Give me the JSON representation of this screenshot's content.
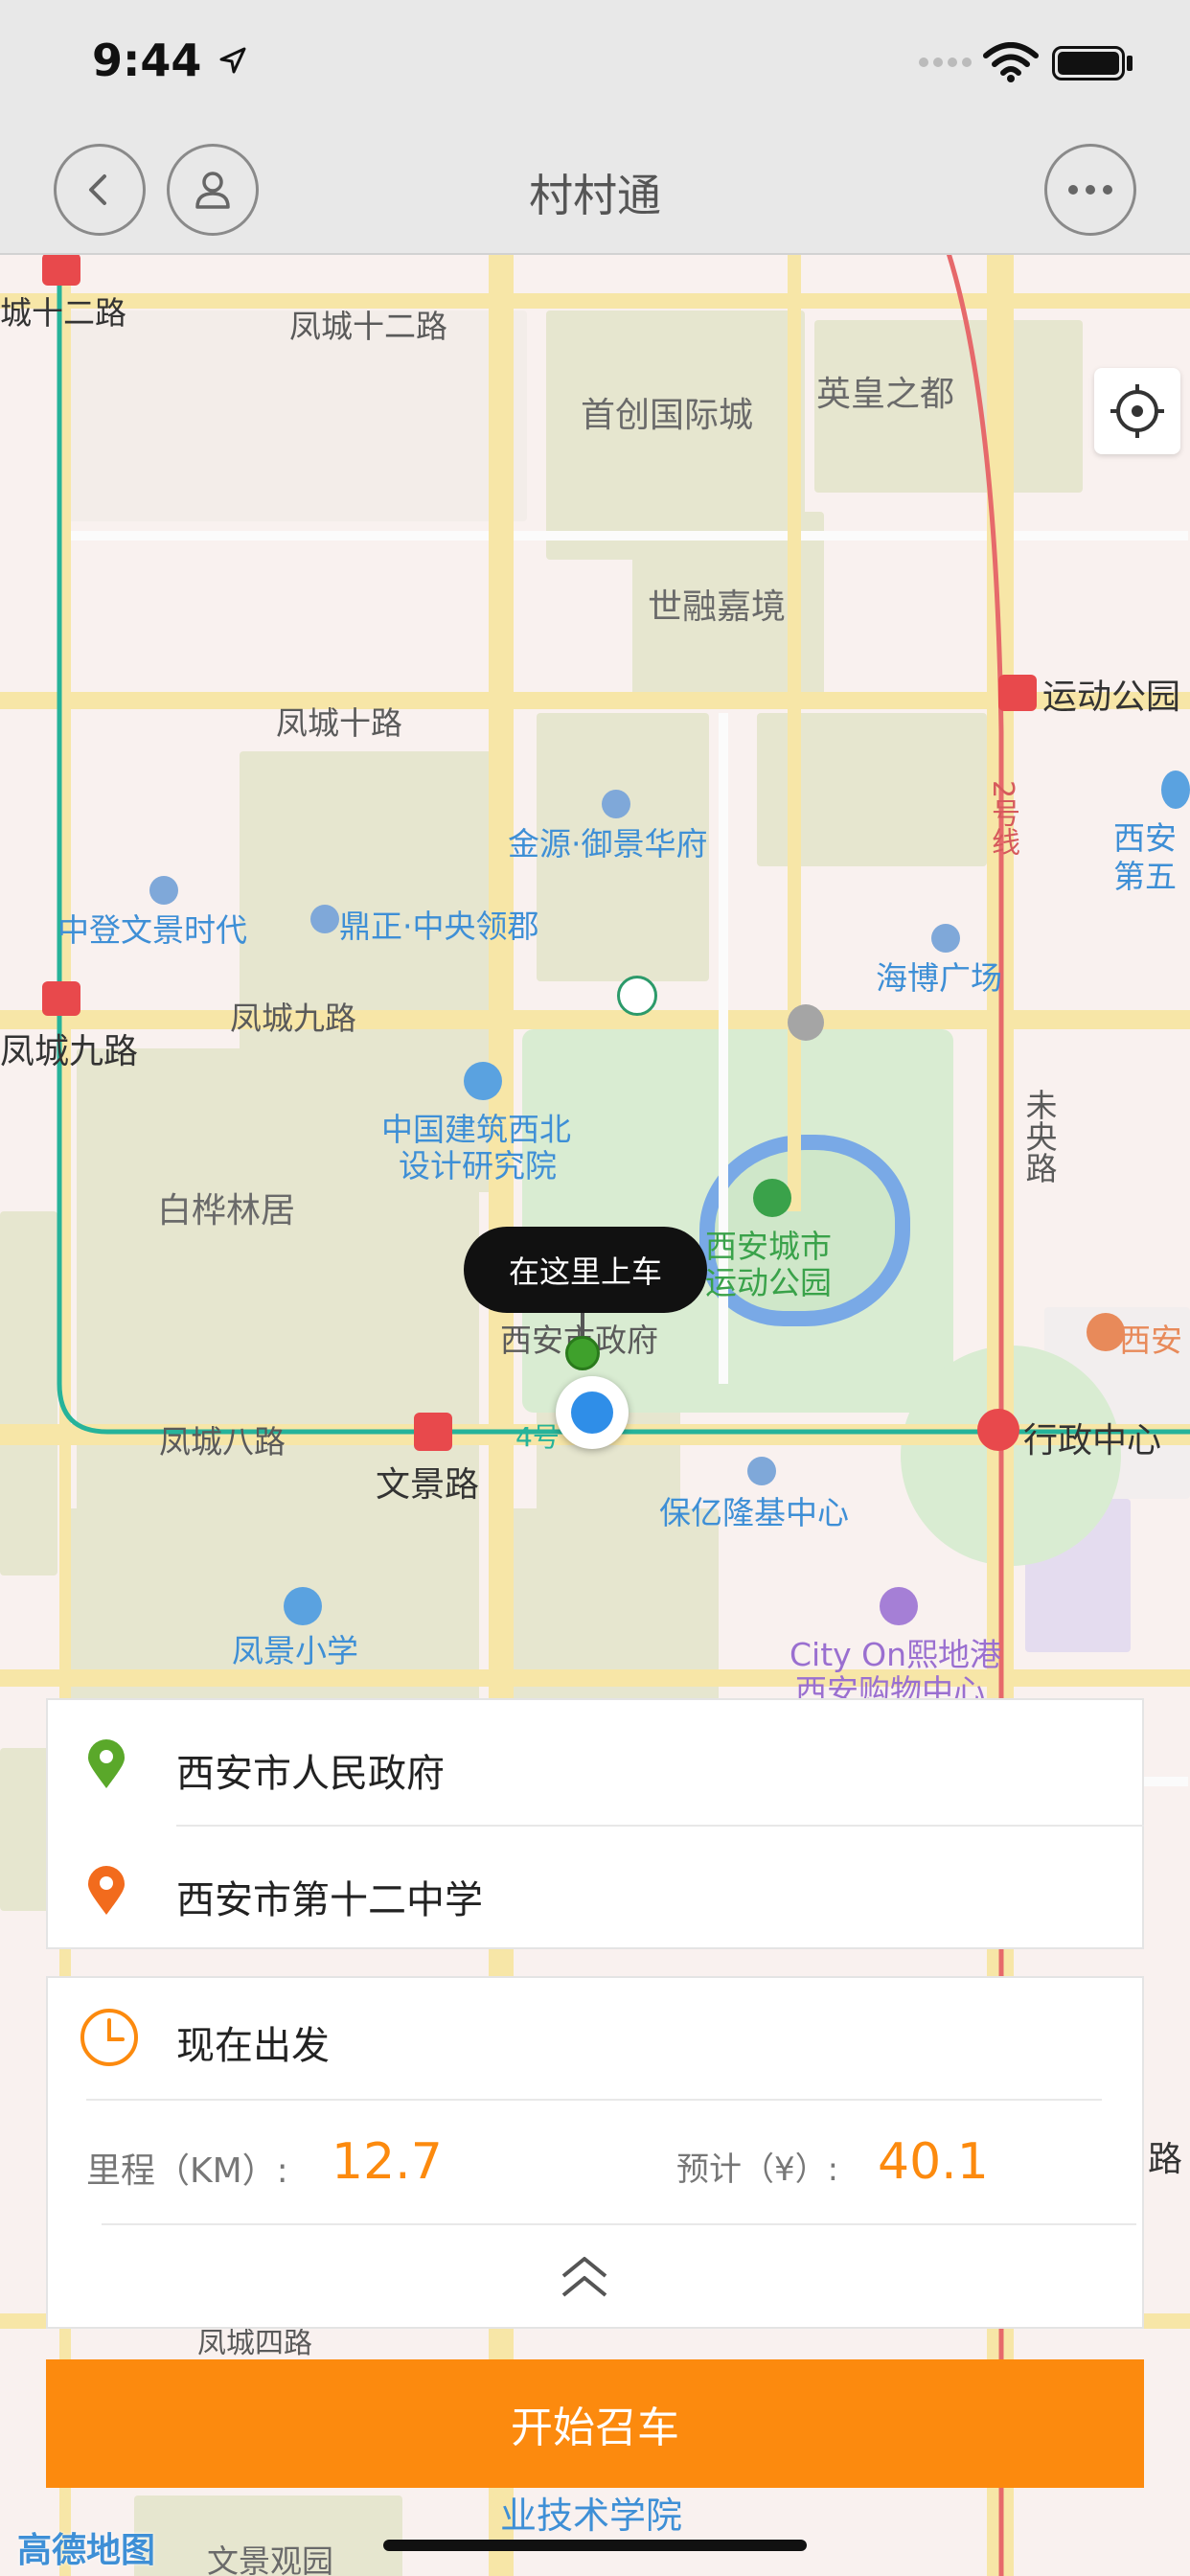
{
  "status_bar": {
    "time": "9:44"
  },
  "nav": {
    "title": "村村通"
  },
  "map": {
    "labels": {
      "r1": "凤城十二路",
      "r1b": "城十二路",
      "shouchuang": "首创国际城",
      "yinghuang": "英皇之都",
      "shirong": "世融嘉境",
      "r10": "凤城十路",
      "yundong": "运动公园",
      "jinyuan": "金源·御景华府",
      "xian_di5": "西安",
      "xian_di5b": "第五",
      "zhongdeng": "中登文景时代",
      "dingzheng": "鼎正·中央领郡",
      "haibo": "海博广场",
      "line2": "2号线",
      "r9": "凤城九路",
      "r9b": "凤城九路",
      "zhongjian1": "中国建筑西北",
      "zhongjian2": "设计研究院",
      "weiyang": "未央路",
      "baihua": "白桦林居",
      "xian_park1": "西安城市",
      "xian_park2": "运动公园",
      "gov": "西安市政府",
      "xian_r": "西安",
      "r8": "凤城八路",
      "line4": "4号",
      "xingzheng": "行政中心",
      "wenjing": "文景路",
      "baoyi": "保亿隆基中心",
      "fengjing": "凤景小学",
      "cityon1": "City On熙地港",
      "cityon2": "西安购物中心",
      "r4": "凤城四路",
      "edge_lu": "路",
      "zhiye": "业技术学院",
      "wenjingguan": "文景观园",
      "amap": "高德地图"
    },
    "pickup_tooltip": "在这里上车"
  },
  "route": {
    "origin": "西安市人民政府",
    "destination": "西安市第十二中学"
  },
  "trip": {
    "depart": "现在出发",
    "distance_label": "里程（KM）:",
    "distance_value": "12.7",
    "price_label": "预计（¥）:",
    "price_value": "40.1"
  },
  "cta": {
    "label": "开始召车"
  },
  "colors": {
    "accent": "#fc8a0e",
    "origin_pin": "#5aa82a",
    "destination_pin": "#f26b1d",
    "metro": "#26b39a"
  },
  "icons": [
    "back-icon",
    "user-icon",
    "more-icon",
    "locate-icon",
    "clock-icon",
    "chevron-up-double-icon"
  ]
}
